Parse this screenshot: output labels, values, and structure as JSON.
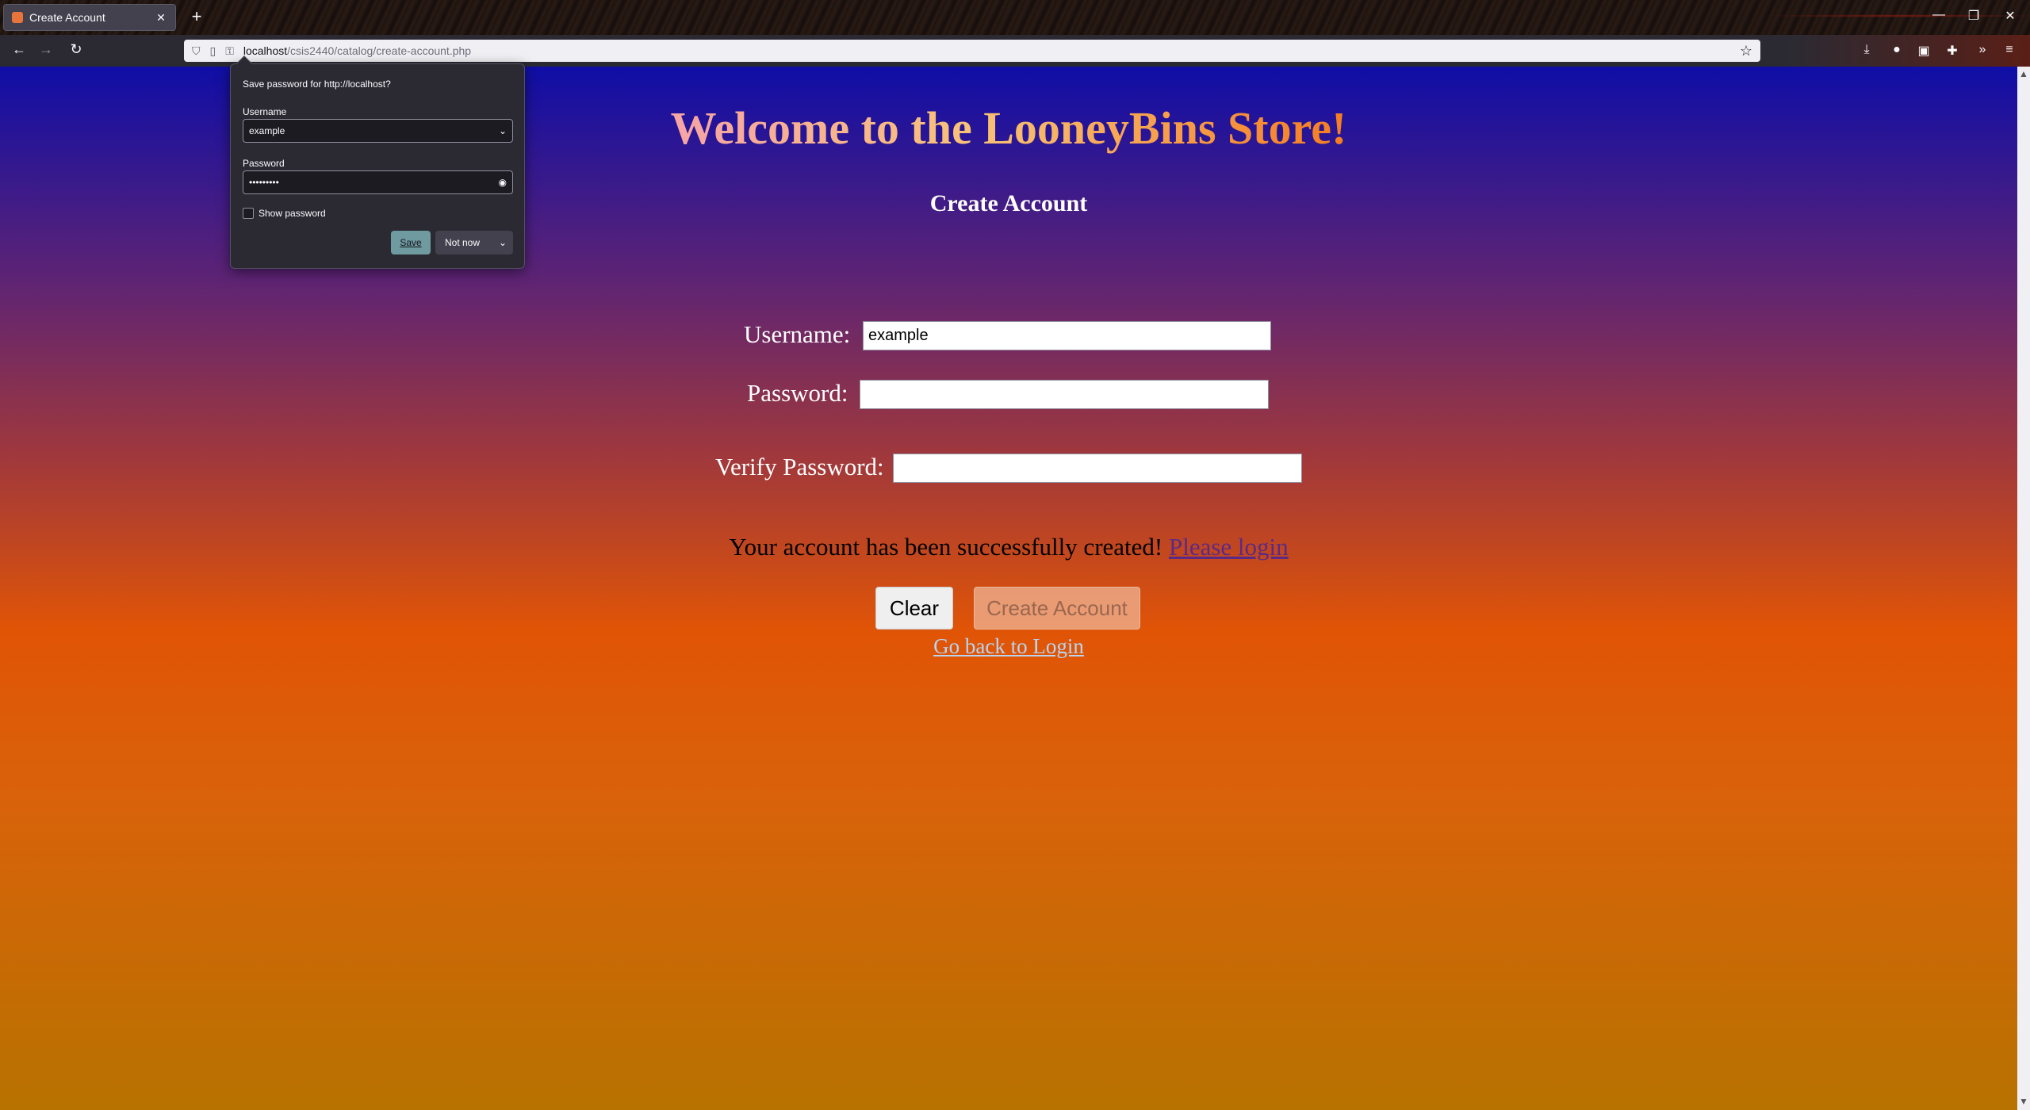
{
  "browser": {
    "tab_title": "Create Account",
    "new_tab": "+",
    "url_host": "localhost",
    "url_path": "/csis2440/catalog/create-account.php",
    "window_controls": [
      "minimize-icon",
      "restore-icon",
      "close-icon"
    ]
  },
  "page": {
    "welcome": "Welcome to the LooneyBins Store!",
    "subtitle": "Create Account",
    "username_label": "Username:",
    "username_value": "example",
    "password_label": "Password:",
    "password_value": "",
    "verify_label": "Verify Password:",
    "verify_value": "",
    "message_text": "Your account has been successfully created!",
    "message_link": "Please login",
    "clear_label": "Clear",
    "create_label": "Create Account",
    "back_link": "Go back to Login"
  },
  "popup": {
    "title": "Save password for http://localhost?",
    "username_label": "Username",
    "username_value": "example",
    "password_label": "Password",
    "password_value": "•••••••••",
    "show_password_label": "Show password",
    "show_password_checked": false,
    "save_label": "Save",
    "not_now_label": "Not now"
  },
  "colors": {
    "gradient_top": "#0f0ea6",
    "gradient_mid": "#e05406",
    "gradient_bottom": "#b87200",
    "link_message": "#5b2a86",
    "link_back": "#b6d6f4"
  }
}
